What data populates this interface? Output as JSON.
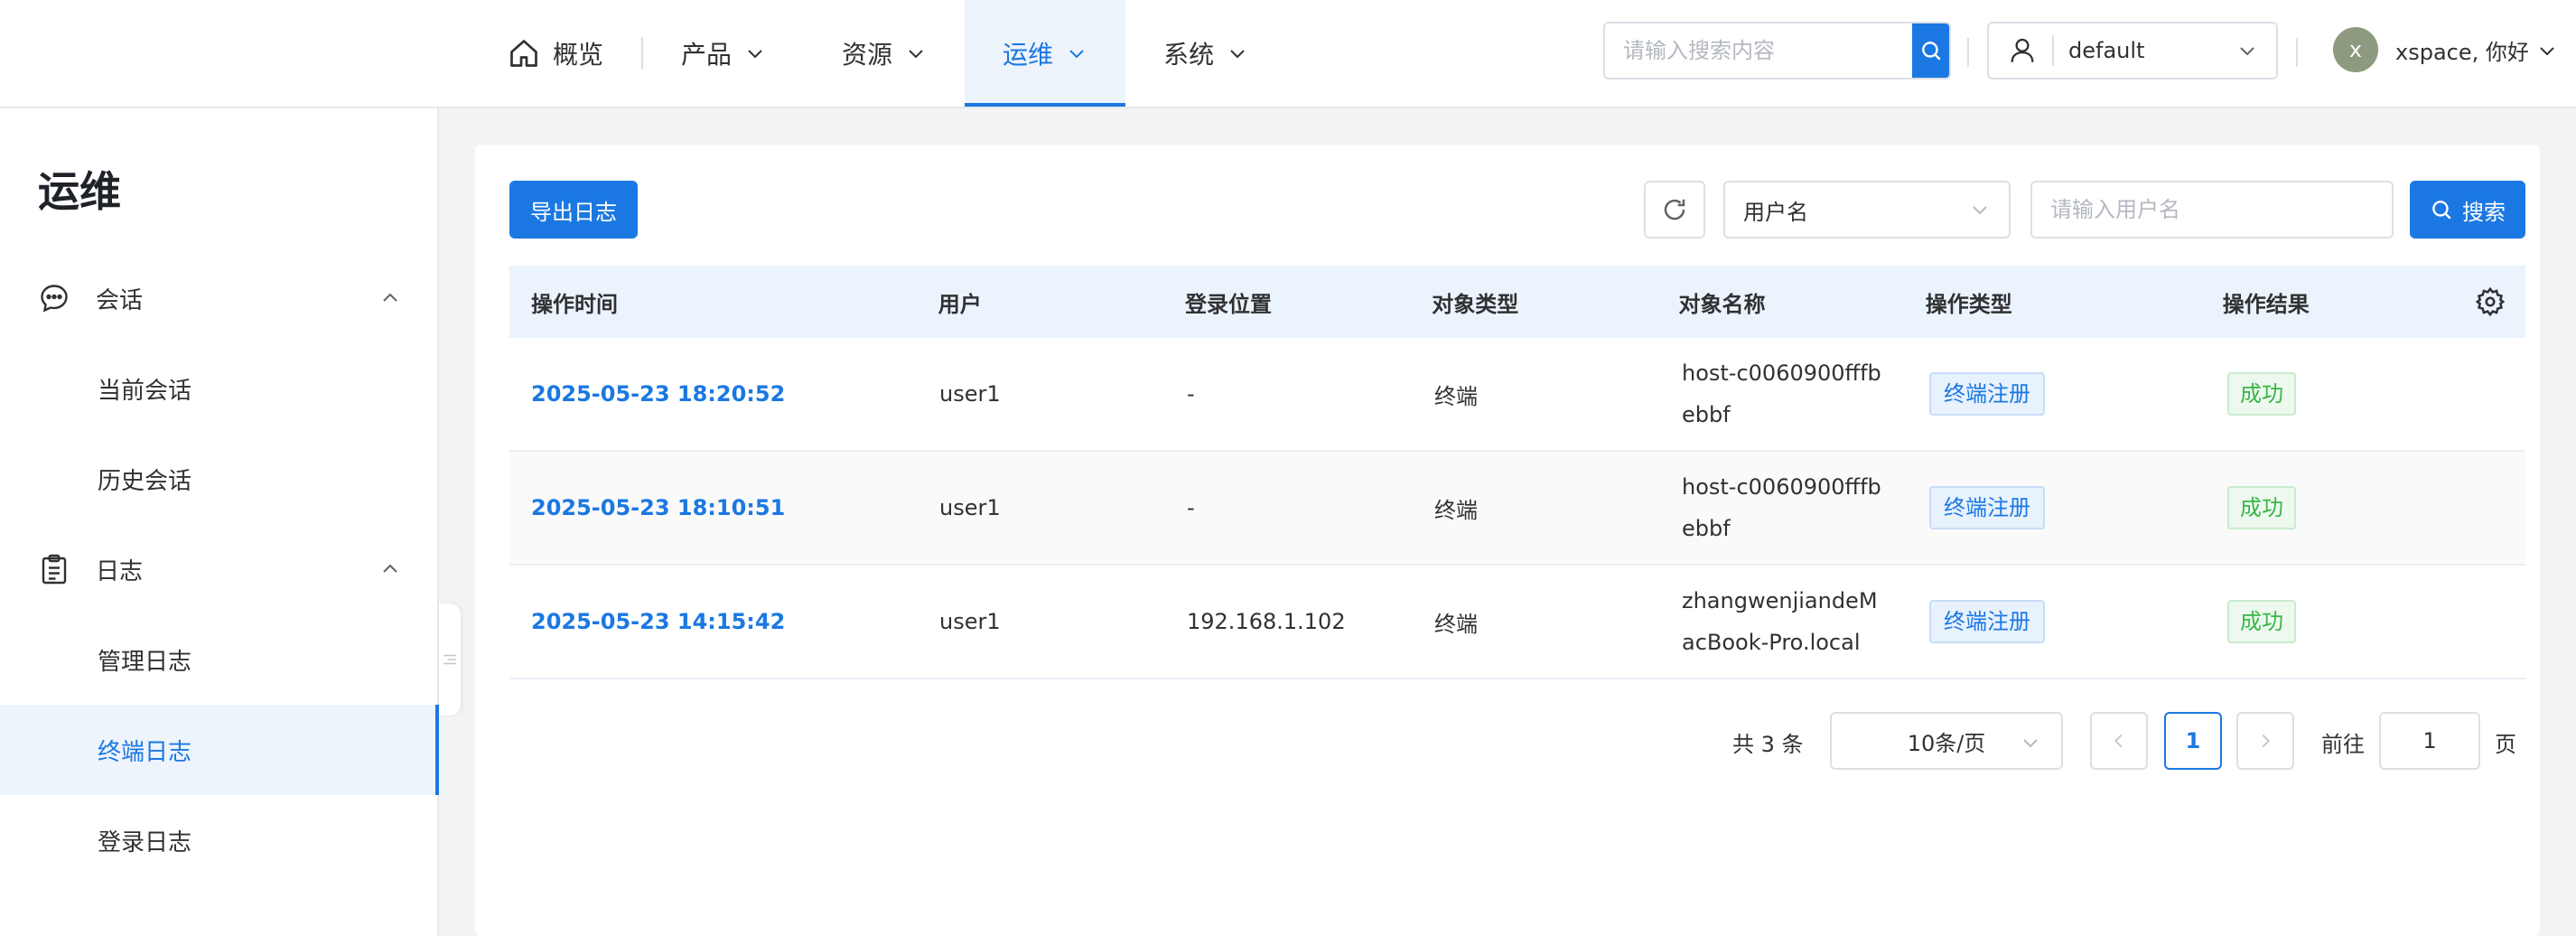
{
  "nav": {
    "items": [
      {
        "label": "概览"
      },
      {
        "label": "产品"
      },
      {
        "label": "资源"
      },
      {
        "label": "运维"
      },
      {
        "label": "系统"
      }
    ]
  },
  "header": {
    "search_placeholder": "请输入搜索内容",
    "namespace": "default",
    "avatar_letter": "x",
    "greeting": "xspace, 你好"
  },
  "sidebar": {
    "title": "运维",
    "groups": [
      {
        "label": "会话",
        "items": [
          "当前会话",
          "历史会话"
        ]
      },
      {
        "label": "日志",
        "items": [
          "管理日志",
          "终端日志",
          "登录日志"
        ]
      }
    ]
  },
  "toolbar": {
    "export_label": "导出日志",
    "field_select": "用户名",
    "user_placeholder": "请输入用户名",
    "search_label": "搜索"
  },
  "table": {
    "columns": [
      "操作时间",
      "用户",
      "登录位置",
      "对象类型",
      "对象名称",
      "操作类型",
      "操作结果"
    ],
    "rows": [
      {
        "time": "2025-05-23 18:20:52",
        "user": "user1",
        "location": "-",
        "obj_type": "终端",
        "obj_name": "host-c0060900fffbebbf",
        "op_type": "终端注册",
        "result": "成功"
      },
      {
        "time": "2025-05-23 18:10:51",
        "user": "user1",
        "location": "-",
        "obj_type": "终端",
        "obj_name": "host-c0060900fffbebbf",
        "op_type": "终端注册",
        "result": "成功"
      },
      {
        "time": "2025-05-23 14:15:42",
        "user": "user1",
        "location": "192.168.1.102",
        "obj_type": "终端",
        "obj_name": "zhangwenjiandeMacBook-Pro.local",
        "op_type": "终端注册",
        "result": "成功"
      }
    ]
  },
  "pagination": {
    "total": "共 3 条",
    "page_size": "10条/页",
    "current_page": "1",
    "goto_label": "前往",
    "goto_value": "1",
    "page_suffix": "页"
  },
  "colors": {
    "accent": "#1b78e2",
    "success": "#3ab549",
    "header_bg": "#ebf3fc"
  },
  "icons": [
    "home-icon",
    "chevron-down-icon",
    "search-icon",
    "user-icon",
    "chat-icon",
    "clipboard-icon",
    "chevron-up-icon",
    "refresh-icon",
    "settings-icon",
    "chevron-left-icon",
    "chevron-right-icon"
  ]
}
